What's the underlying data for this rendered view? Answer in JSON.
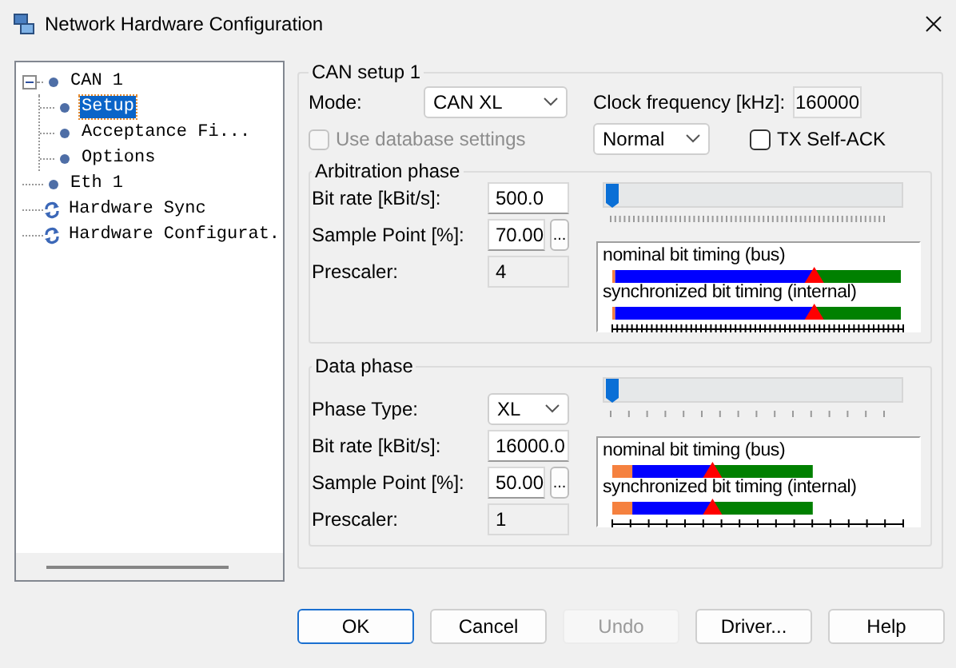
{
  "window": {
    "title": "Network Hardware Configuration"
  },
  "tree": [
    {
      "label": "CAN 1",
      "kind": "node",
      "selected": false,
      "expanded": true,
      "children": [
        {
          "label": "Setup",
          "kind": "node",
          "selected": true
        },
        {
          "label": "Acceptance Fi...",
          "kind": "node",
          "selected": false
        },
        {
          "label": "Options",
          "kind": "node",
          "selected": false
        }
      ]
    },
    {
      "label": "Eth 1",
      "kind": "node",
      "selected": false
    },
    {
      "label": "Hardware Sync",
      "kind": "sync",
      "selected": false
    },
    {
      "label": "Hardware Configurat.",
      "kind": "sync",
      "selected": false
    }
  ],
  "setup": {
    "title": "CAN setup 1",
    "mode": {
      "label": "Mode:",
      "value": "CAN XL"
    },
    "clock": {
      "label": "Clock frequency [kHz]:",
      "value": "160000"
    },
    "use_database": {
      "label": "Use database settings",
      "checked": false,
      "disabled": true
    },
    "operation": {
      "value": "Normal"
    },
    "tx_self_ack": {
      "label": "TX Self-ACK",
      "checked": false,
      "disabled": false
    }
  },
  "phases": [
    {
      "kind": "arbitration",
      "title": "Arbitration phase",
      "slider": {
        "level": 0
      },
      "fields": [
        {
          "kind": "input",
          "label": "Bit rate [kBit/s]:",
          "value": "500.0"
        },
        {
          "kind": "input_button",
          "label": "Sample Point [%]:",
          "value": "70.00",
          "button": "..."
        },
        {
          "kind": "readonly",
          "label": "Prescaler:",
          "value": "4"
        }
      ],
      "timing": [
        {
          "label": "nominal bit timing (bus)"
        },
        {
          "label": "synchronized bit timing (internal)"
        }
      ]
    },
    {
      "kind": "data",
      "title": "Data phase",
      "slider": {
        "level": 0
      },
      "fields": [
        {
          "kind": "select",
          "label": "Phase Type:",
          "value": "XL"
        },
        {
          "kind": "input",
          "label": "Bit rate [kBit/s]:",
          "value": "16000.0"
        },
        {
          "kind": "input_button",
          "label": "Sample Point [%]:",
          "value": "50.00",
          "button": "..."
        },
        {
          "kind": "readonly",
          "label": "Prescaler:",
          "value": "1"
        }
      ],
      "timing": [
        {
          "label": "nominal bit timing (bus)"
        },
        {
          "label": "synchronized bit timing (internal)"
        }
      ]
    }
  ],
  "buttons": [
    {
      "label": "OK",
      "default": true,
      "disabled": false
    },
    {
      "label": "Cancel",
      "default": false,
      "disabled": false
    },
    {
      "label": "Undo",
      "default": false,
      "disabled": true
    },
    {
      "label": "Driver...",
      "default": false,
      "disabled": false
    },
    {
      "label": "Help",
      "default": false,
      "disabled": false
    }
  ]
}
